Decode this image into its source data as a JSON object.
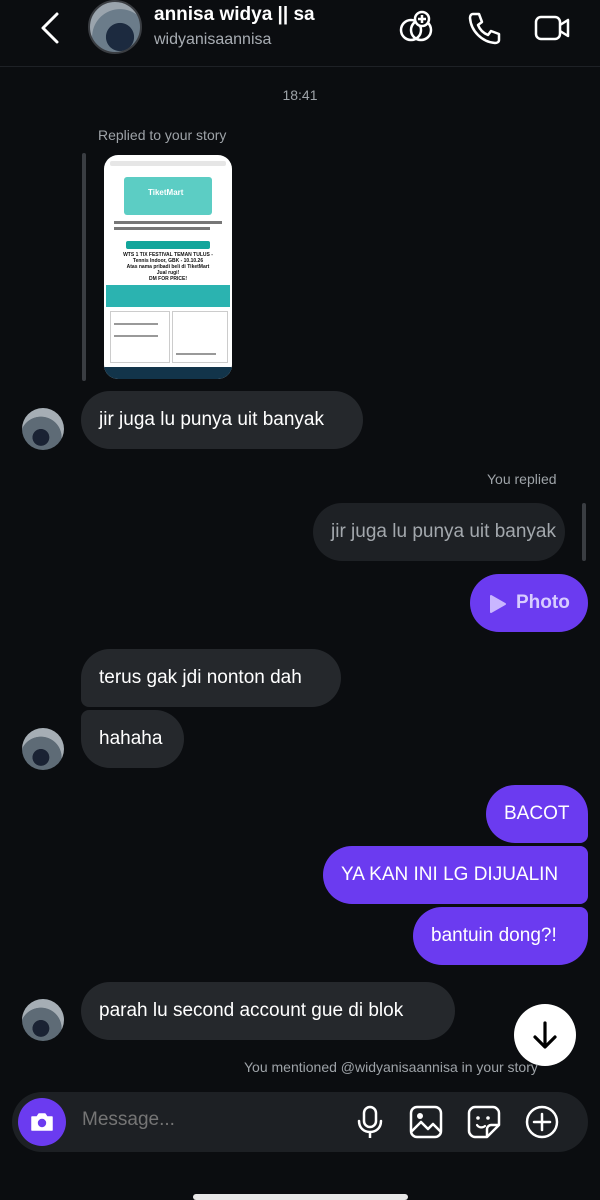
{
  "header": {
    "name": "annisa widya || sa",
    "handle": "widyanisaannisa"
  },
  "chat": {
    "timestamp": "18:41",
    "replied_story_label": "Replied to your story",
    "story_preview": {
      "brand": "TiketMart",
      "lines": [
        "WTS 1 TIX FESTIVAL TEMAN TULUS -",
        "Tennis Indoor, GBK - 10.10.26",
        "Atas nama pribadi beli di TiketMart",
        "Jual rugi!",
        "DM FOR PRICE!"
      ]
    },
    "msg1": "jir juga lu punya uit banyak",
    "you_replied_label": "You replied",
    "reply_quote": "jir juga lu punya uit banyak",
    "photo_label": "Photo",
    "msg2": "terus gak jdi nonton dah",
    "msg3": "hahaha",
    "msg4": "BACOT",
    "msg5": "YA KAN INI LG DIJUALIN",
    "msg6": "bantuin dong?!",
    "msg7": "parah lu second account gue di blok",
    "mention_note": "You mentioned @widyanisaannisa in your story"
  },
  "composer": {
    "placeholder": "Message..."
  },
  "colors": {
    "background": "#0b0d10",
    "incoming_bubble": "#25282c",
    "outgoing_bubble": "#6b3bf0",
    "accent": "#6b3bf0"
  },
  "icons": [
    "back-arrow-icon",
    "effects-icon",
    "phone-icon",
    "video-icon",
    "camera-icon",
    "microphone-icon",
    "gallery-icon",
    "sticker-icon",
    "plus-icon",
    "arrow-down-icon",
    "play-icon"
  ]
}
